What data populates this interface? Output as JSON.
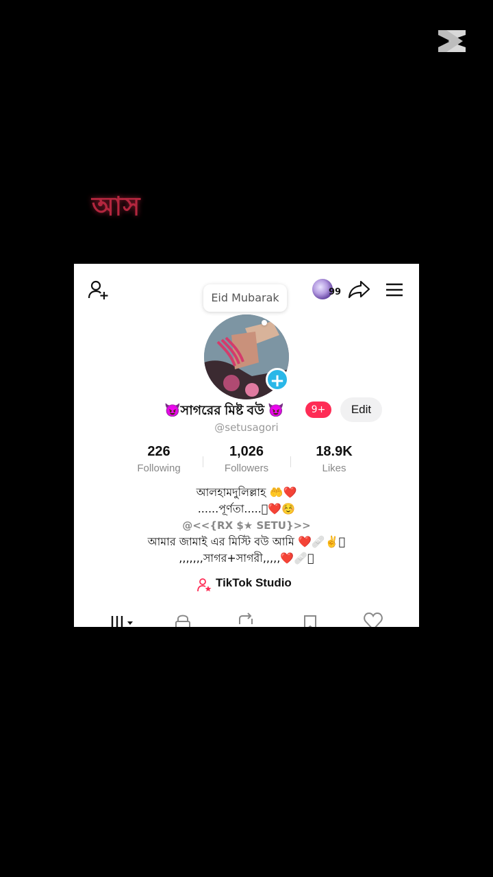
{
  "overlay": {
    "text": "আস"
  },
  "header": {
    "notification_count": "99"
  },
  "note": {
    "text": "Eid Mubarak"
  },
  "profile": {
    "display_name": "😈সাগরের মিষ্ট বউ 😈",
    "badge": "9+",
    "edit_label": "Edit",
    "username": "@setusagori"
  },
  "stats": {
    "following": {
      "value": "226",
      "label": "Following"
    },
    "followers": {
      "value": "1,026",
      "label": "Followers"
    },
    "likes": {
      "value": "18.9K",
      "label": "Likes"
    }
  },
  "bio": {
    "line1": "আলহামদুলিল্লাহ 🤲❤️",
    "line2": "......পূর্ণতা.....􏰀❤️☺️",
    "line3": "@<<{RX $★ SETU}>>",
    "line4": "আমার জামাই এর মিস্টি বউ আমি ❤️🩹✌️􏰀",
    "line5": ",,,,,,,সাগর+সাগরী,,,,,❤️🩹􏰀"
  },
  "studio": {
    "label": "TikTok Studio"
  },
  "colors": {
    "accent": "#fe2c55",
    "add_button": "#2ab7e8",
    "background": "#000000"
  },
  "icons": {
    "add_user": "add-user-icon",
    "share": "share-icon",
    "menu": "menu-icon",
    "studio": "studio-icon",
    "tabs": [
      "grid-icon",
      "lock-icon",
      "repost-icon",
      "bookmark-icon",
      "heart-icon"
    ]
  }
}
